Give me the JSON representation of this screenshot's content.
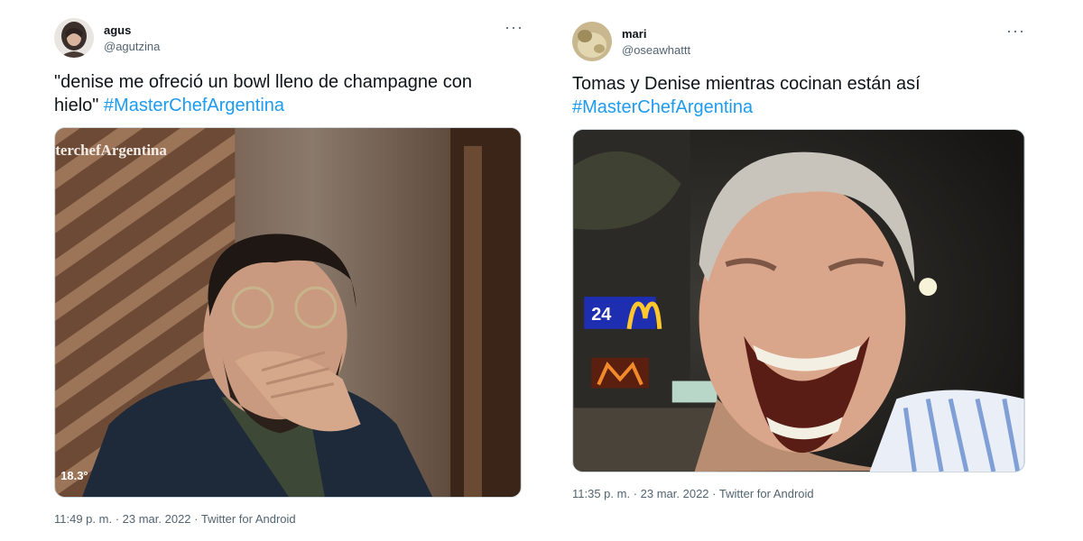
{
  "tweets": [
    {
      "display_name": "agus",
      "handle": "@agutzina",
      "more": "···",
      "text": "\"denise me ofreció un bowl lleno de champagne con hielo\"",
      "hashtag": "#MasterChefArgentina",
      "media": {
        "overlay_watermark": "terchefArgentina",
        "overlay_temp": "18.3°"
      },
      "time": "11:49 p. m.",
      "date": "23 mar. 2022",
      "source": "Twitter for Android"
    },
    {
      "display_name": "mari",
      "handle": "@oseawhattt",
      "more": "···",
      "text": "Tomas y Denise mientras cocinan están así",
      "hashtag": "#MasterChefArgentina",
      "media": {},
      "time": "11:35 p. m.",
      "date": "23 mar. 2022",
      "source": "Twitter for Android"
    }
  ],
  "separator": " · "
}
